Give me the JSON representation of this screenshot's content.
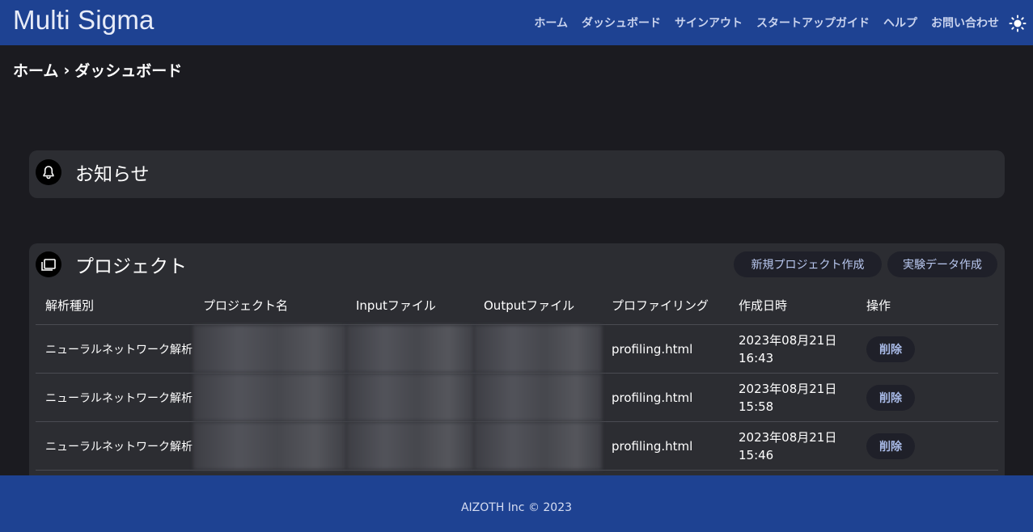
{
  "app": {
    "brand": "Multi Sigma"
  },
  "nav": [
    "ホーム",
    "ダッシュボード",
    "サインアウト",
    "スタートアップガイド",
    "ヘルプ",
    "お問い合わせ"
  ],
  "breadcrumb": {
    "home": "ホーム",
    "separator": "›",
    "current": "ダッシュボード"
  },
  "notice": {
    "title": "お知らせ"
  },
  "projects": {
    "title": "プロジェクト",
    "new_project_label": "新規プロジェクト作成",
    "new_experiment_label": "実験データ作成",
    "columns": [
      "解析種別",
      "プロジェクト名",
      "Inputファイル",
      "Outputファイル",
      "プロファイリング",
      "作成日時",
      "操作"
    ],
    "rows": [
      {
        "type": "ニューラルネットワーク解析",
        "profiling": "profiling.html",
        "date": "2023年08月21日",
        "time": "16:43",
        "action": "削除"
      },
      {
        "type": "ニューラルネットワーク解析",
        "profiling": "profiling.html",
        "date": "2023年08月21日",
        "time": "15:58",
        "action": "削除"
      },
      {
        "type": "ニューラルネットワーク解析",
        "profiling": "profiling.html",
        "date": "2023年08月21日",
        "time": "15:46",
        "action": "削除"
      }
    ]
  },
  "footer": {
    "text": "AIZOTH Inc © 2023"
  },
  "colors": {
    "header_bg": "#1e4292",
    "page_bg": "#1b1b20",
    "card_bg": "#2c2d32",
    "button_bg": "#1f2029"
  },
  "icons": {
    "theme": "sun-icon",
    "notice": "bell-icon",
    "projects": "folders-icon"
  }
}
